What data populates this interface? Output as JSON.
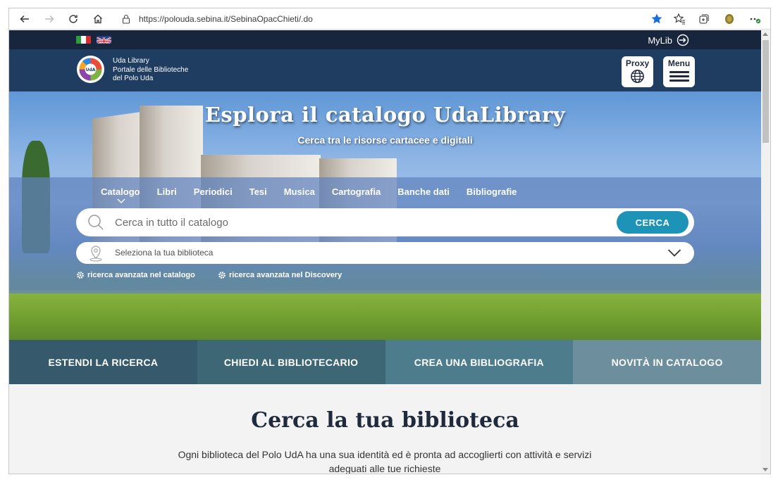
{
  "browser": {
    "url": "https://polouda.sebina.it/SebinaOpacChieti/.do"
  },
  "site": {
    "mylib_label": "MyLib",
    "brand_line1": "Uda Library",
    "brand_line2": "Portale delle Biblioteche",
    "brand_line3": "del Polo Uda",
    "proxy_label": "Proxy",
    "menu_label": "Menu"
  },
  "hero": {
    "title": "Esplora il catalogo UdaLibrary",
    "subtitle": "Cerca tra le risorse cartacee e digitali",
    "tabs": [
      "Catalogo",
      "Libri",
      "Periodici",
      "Tesi",
      "Musica",
      "Cartografia",
      "Banche dati",
      "Bibliografie"
    ],
    "search_placeholder": "Cerca in tutto il catalogo",
    "search_button": "CERCA",
    "library_select": "Seleziona la tua biblioteca",
    "advanced_catalog": "ricerca avanzata nel catalogo",
    "advanced_discovery": "ricerca avanzata nel Discovery"
  },
  "band": {
    "items": [
      "ESTENDI LA RICERCA",
      "CHIEDI AL BIBLIOTECARIO",
      "CREA UNA BIBLIOGRAFIA",
      "NOVITÀ IN CATALOGO"
    ],
    "colors": [
      "#365a6b",
      "#3e6775",
      "#4d7d8c",
      "#6c8e9d"
    ]
  },
  "content": {
    "heading": "Cerca la tua biblioteca",
    "text": "Ogni biblioteca del Polo UdA ha una sua identità ed è pronta ad accoglierti con attività e servizi adeguati alle tue richieste"
  },
  "colors": {
    "topbar": "#18263d",
    "header": "#1f3d61",
    "accent": "#1e93b8"
  }
}
